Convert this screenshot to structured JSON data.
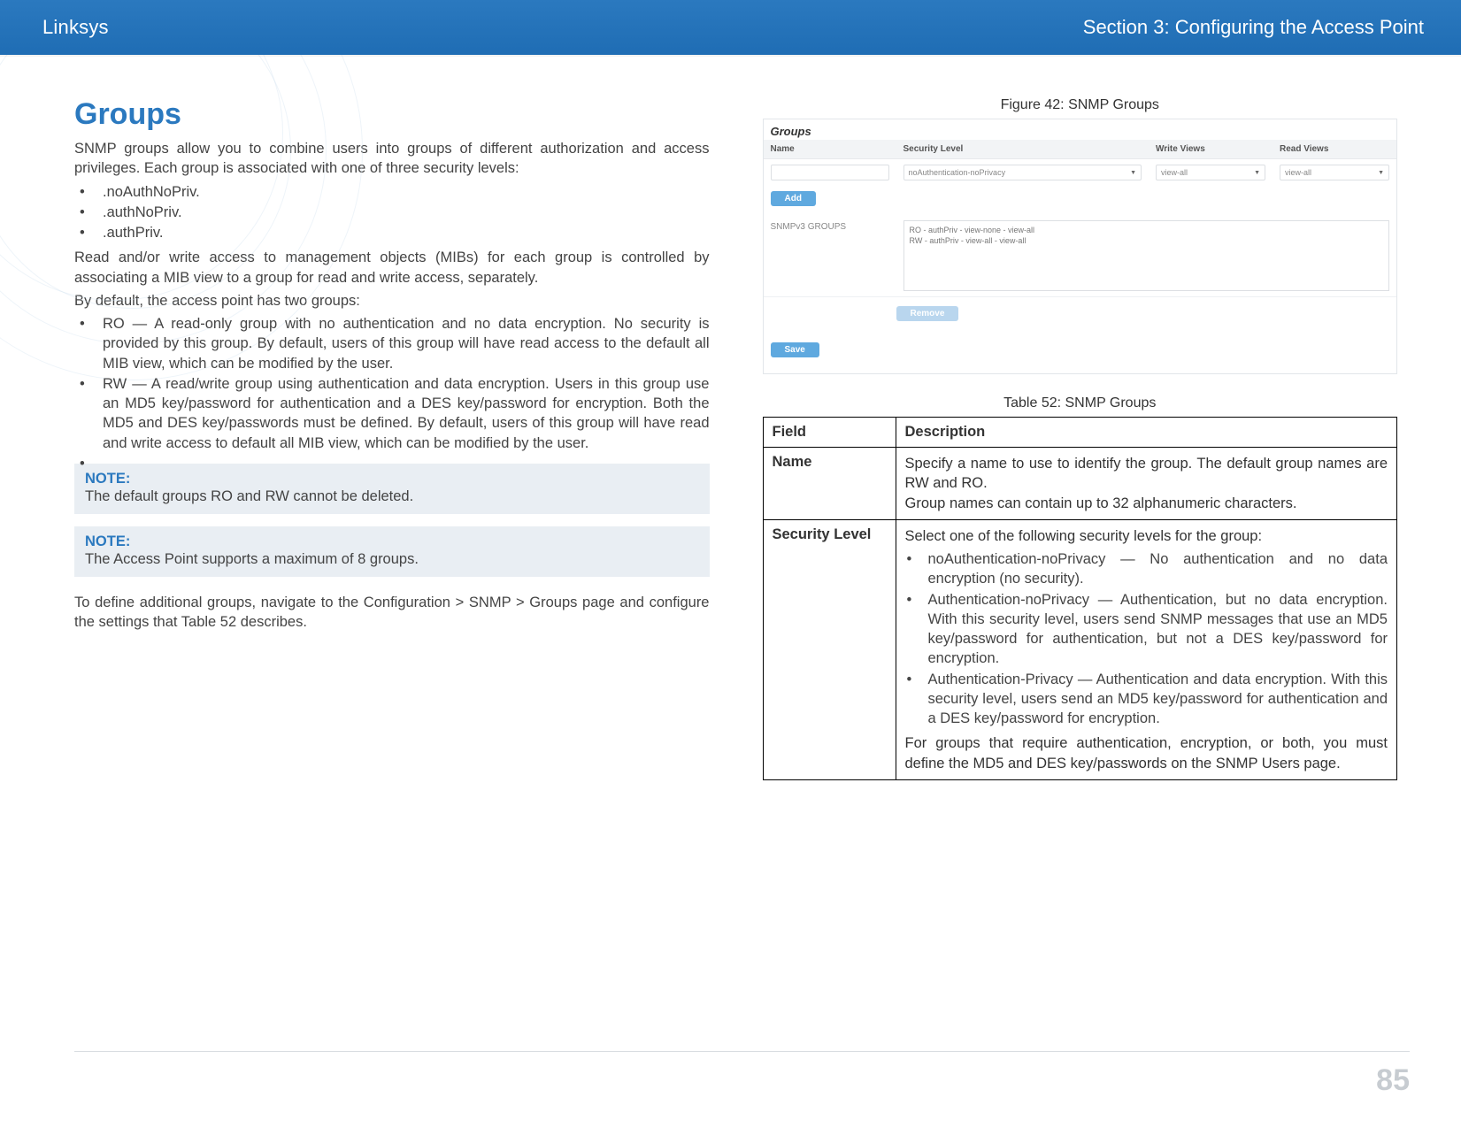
{
  "header": {
    "brand": "Linksys",
    "section": "Section 3:  Configuring the Access Point"
  },
  "left": {
    "title": "Groups",
    "intro": "SNMP groups allow you to combine users into groups of different authorization and access privileges. Each group is associated with one of three security levels:",
    "levels": [
      ".noAuthNoPriv.",
      ".authNoPriv.",
      ".authPriv."
    ],
    "para2": "Read and/or write access to management objects (MIBs) for each group is controlled by associating a MIB view to a group for read and write access, separately.",
    "para3": "By default, the access point has two groups:",
    "defaults": [
      "RO — A read-only group with no authentication and no data encryption. No security is provided by this group. By default, users of this group will have read access to the default all MIB view, which can be modified by the user.",
      "RW — A read/write group using authentication and data encryption. Users in this group use an MD5 key/password for authentication and a DES key/password for encryption. Both the MD5 and DES key/passwords must be defined. By default, users of this group will have read and write access to default all MIB view, which can be modified by the user."
    ],
    "note1_label": "NOTE:",
    "note1_body": "The default groups RO and RW cannot be deleted.",
    "note2_label": "NOTE:",
    "note2_body": "The Access Point supports a maximum of 8 groups.",
    "tail": "To define additional groups, navigate to the Configuration > SNMP > Groups page and configure the settings that Table 52 describes."
  },
  "figure": {
    "caption": "Figure 42: SNMP Groups",
    "mini": {
      "title": "Groups",
      "cols": {
        "name": "Name",
        "sec": "Security Level",
        "write": "Write Views",
        "read": "Read Views"
      },
      "sec_opt": "noAuthentication-noPrivacy",
      "view_opt": "view-all",
      "add": "Add",
      "list_label": "SNMPv3 GROUPS",
      "list_rows": [
        "RO - authPriv - view-none - view-all",
        "RW - authPriv - view-all - view-all"
      ],
      "remove": "Remove",
      "save": "Save"
    }
  },
  "table": {
    "caption": "Table 52: SNMP Groups",
    "head": {
      "field": "Field",
      "desc": "Description"
    },
    "rows": [
      {
        "field": "Name",
        "desc_p1": "Specify a name to use to identify the group. The default group names are RW and RO.",
        "desc_p2": "Group names can contain up to 32 alphanumeric characters."
      },
      {
        "field": "Security Level",
        "desc_intro": "Select one of the following security levels for the group:",
        "bullets": [
          "noAuthentication-noPrivacy — No authentication and no data encryption (no security).",
          "Authentication-noPrivacy — Authentication, but no data encryption. With this security level, users send SNMP messages that use an MD5 key/password for authentication, but not a DES key/password for encryption.",
          "Authentication-Privacy — Authentication and data encryption. With this security level, users send an MD5 key/password for authentication and a DES key/password for encryption."
        ],
        "desc_tail": "For groups that require authentication, encryption, or both, you must define the MD5 and DES key/passwords on the SNMP Users page."
      }
    ]
  },
  "page_number": "85"
}
